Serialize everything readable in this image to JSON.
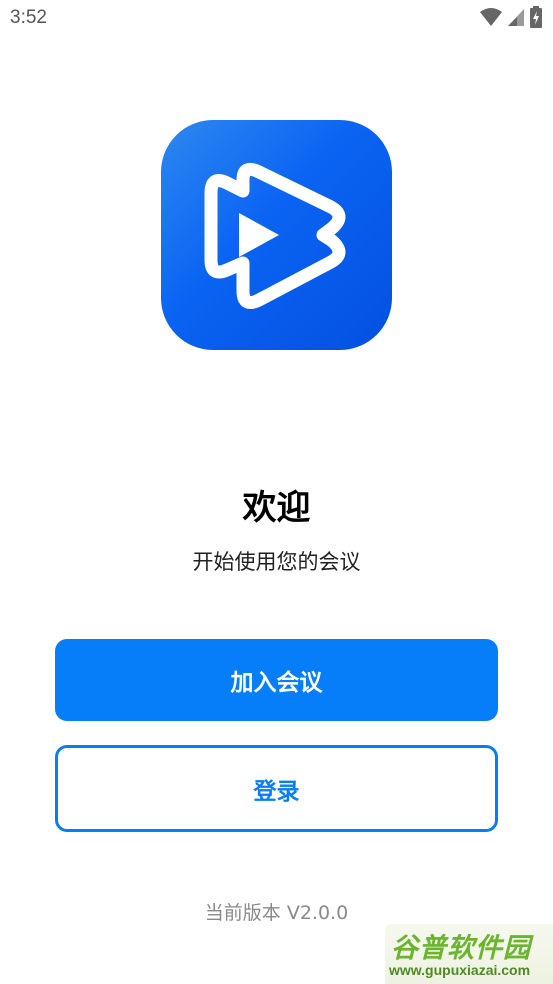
{
  "status_bar": {
    "time": "3:52",
    "icons": [
      "wifi-icon",
      "cellular-signal-icon",
      "battery-charging-icon"
    ]
  },
  "app": {
    "logo_icon": "play-logo-icon",
    "brand_colors": {
      "primary": "#067ef9",
      "logo_gradient_start": "#2e88f0",
      "logo_gradient_end": "#0450e0"
    }
  },
  "welcome": {
    "title": "欢迎",
    "subtitle": "开始使用您的会议"
  },
  "actions": {
    "join_label": "加入会议",
    "login_label": "登录"
  },
  "footer": {
    "version": "当前版本 V2.0.0"
  },
  "watermark": {
    "name": "谷普软件园",
    "url": "www.gupuxiazai.com"
  }
}
